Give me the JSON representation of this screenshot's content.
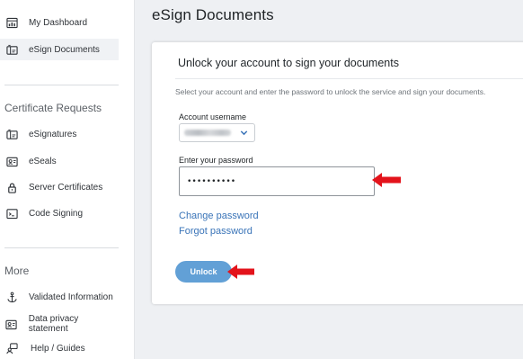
{
  "sidebar": {
    "items_top": [
      {
        "label": "My Dashboard",
        "icon": "dashboard-icon"
      },
      {
        "label": "eSign Documents",
        "icon": "esign-documents-icon",
        "active": true
      }
    ],
    "sections": [
      {
        "title": "Certificate Requests",
        "items": [
          {
            "label": "eSignatures",
            "icon": "esignatures-icon"
          },
          {
            "label": "eSeals",
            "icon": "eseal-icon"
          },
          {
            "label": "Server Certificates",
            "icon": "lock-icon"
          },
          {
            "label": "Code Signing",
            "icon": "code-signing-icon"
          }
        ]
      },
      {
        "title": "More",
        "items": [
          {
            "label": "Validated Information",
            "icon": "anchor-icon"
          },
          {
            "label": "Data privacy statement",
            "icon": "id-card-icon"
          },
          {
            "label": "Help / Guides",
            "icon": "help-guides-icon"
          }
        ]
      }
    ]
  },
  "main": {
    "title": "eSign Documents",
    "card": {
      "title": "Unlock your account to sign your documents",
      "description": "Select your account and enter the password to unlock the service and sign your documents.",
      "account_label": "Account username",
      "password_label": "Enter your password",
      "password_value": "••••••••••",
      "change_password_link": "Change password",
      "forgot_password_link": "Forgot password",
      "unlock_button": "Unlock"
    }
  },
  "colors": {
    "accent_button": "#62a0d6",
    "link": "#3a74b8",
    "annotation_arrow": "#e3131b",
    "page_background": "#eef0f3"
  }
}
